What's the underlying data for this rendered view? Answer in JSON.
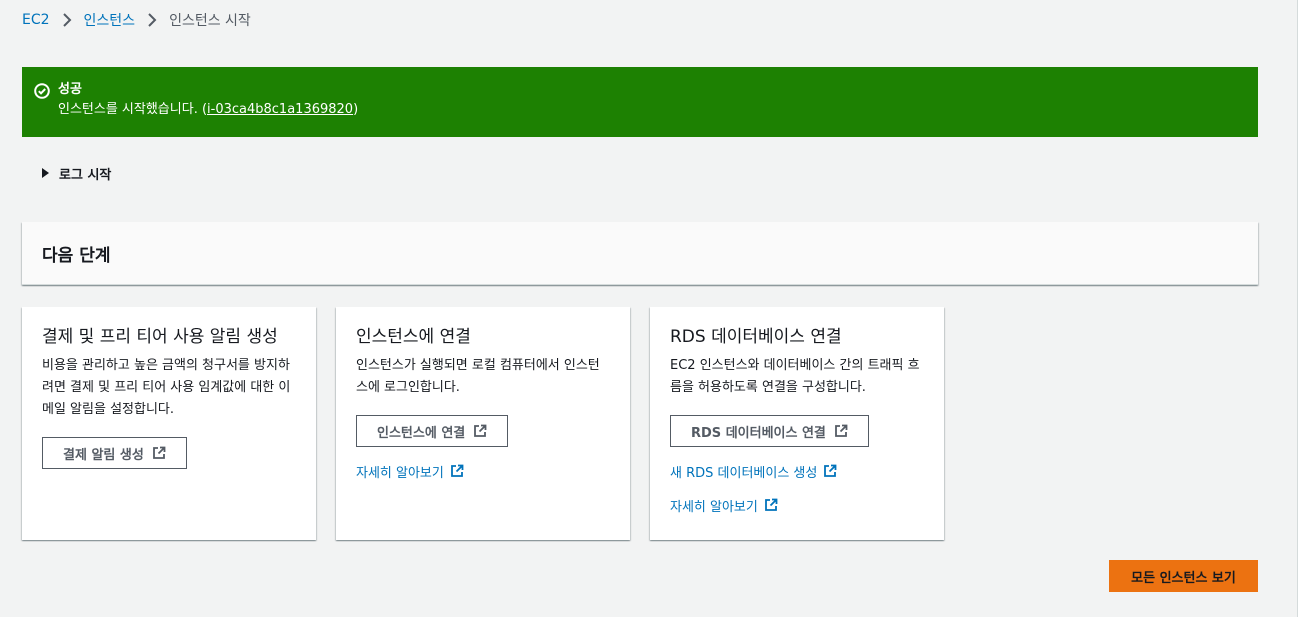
{
  "breadcrumb": {
    "items": [
      "EC2",
      "인스턴스"
    ],
    "current": "인스턴스 시작"
  },
  "flash": {
    "type": "success",
    "title": "성공",
    "message_prefix": "인스턴스를 시작했습니다. (",
    "instance_id": "i-03ca4b8c1a1369820",
    "message_suffix": ")",
    "color": "#1d8102"
  },
  "launch_log": {
    "label": "로그 시작"
  },
  "next_steps": {
    "title": "다음 단계",
    "cards": [
      {
        "title": "결제 및 프리 티어 사용 알림 생성",
        "description": "비용을 관리하고 높은 금액의 청구서를 방지하려면 결제 및 프리 티어 사용 임계값에 대한 이메일 알림을 설정합니다.",
        "button": "결제 알림 생성"
      },
      {
        "title": "인스턴스에 연결",
        "description": "인스턴스가 실행되면 로컬 컴퓨터에서 인스턴스에 로그인합니다.",
        "button": "인스턴스에 연결",
        "link": "자세히 알아보기"
      },
      {
        "title": "RDS 데이터베이스 연결",
        "description": "EC2 인스턴스와 데이터베이스 간의 트래픽 흐름을 허용하도록 연결을 구성합니다.",
        "button": "RDS 데이터베이스 연결",
        "link_1": "새 RDS 데이터베이스 생성",
        "link_2": "자세히 알아보기"
      }
    ]
  },
  "footer": {
    "primary_button": "모든 인스턴스 보기",
    "accent": "#ec7211"
  },
  "colors": {
    "link": "#0073bb",
    "background": "#f2f3f3"
  }
}
